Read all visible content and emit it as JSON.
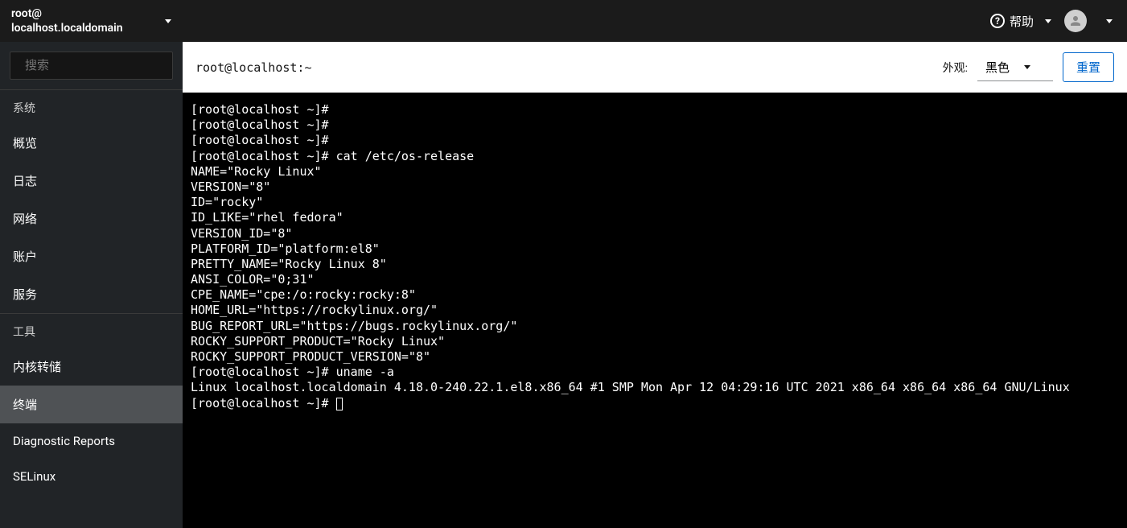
{
  "host": {
    "line1": "root@",
    "line2": "localhost.localdomain"
  },
  "topbar": {
    "help_label": "帮助"
  },
  "sidebar": {
    "search_placeholder": "搜索",
    "groups": [
      {
        "label": "系统",
        "items": [
          {
            "label": "概览"
          },
          {
            "label": "日志"
          },
          {
            "label": "网络"
          },
          {
            "label": "账户"
          },
          {
            "label": "服务"
          }
        ]
      },
      {
        "label": "工具",
        "items": [
          {
            "label": "内核转储"
          },
          {
            "label": "终端",
            "active": true
          },
          {
            "label": "Diagnostic Reports"
          },
          {
            "label": "SELinux"
          }
        ]
      }
    ]
  },
  "toolbar": {
    "title": "root@localhost:~",
    "appearance_label": "外观:",
    "appearance_value": "黑色",
    "reset_label": "重置"
  },
  "terminal": {
    "lines": [
      "[root@localhost ~]# ",
      "[root@localhost ~]# ",
      "[root@localhost ~]# ",
      "[root@localhost ~]# cat /etc/os-release",
      "NAME=\"Rocky Linux\"",
      "VERSION=\"8\"",
      "ID=\"rocky\"",
      "ID_LIKE=\"rhel fedora\"",
      "VERSION_ID=\"8\"",
      "PLATFORM_ID=\"platform:el8\"",
      "PRETTY_NAME=\"Rocky Linux 8\"",
      "ANSI_COLOR=\"0;31\"",
      "CPE_NAME=\"cpe:/o:rocky:rocky:8\"",
      "HOME_URL=\"https://rockylinux.org/\"",
      "BUG_REPORT_URL=\"https://bugs.rockylinux.org/\"",
      "ROCKY_SUPPORT_PRODUCT=\"Rocky Linux\"",
      "ROCKY_SUPPORT_PRODUCT_VERSION=\"8\"",
      "[root@localhost ~]# uname -a",
      "Linux localhost.localdomain 4.18.0-240.22.1.el8.x86_64 #1 SMP Mon Apr 12 04:29:16 UTC 2021 x86_64 x86_64 x86_64 GNU/Linux",
      "[root@localhost ~]# "
    ]
  }
}
